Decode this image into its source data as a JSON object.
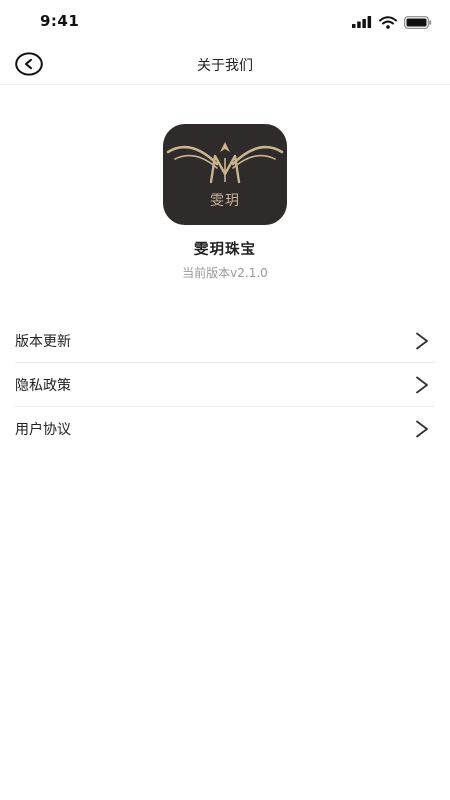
{
  "status_bar": {
    "time": "9:41"
  },
  "nav": {
    "title": "关于我们"
  },
  "app": {
    "logo_text": "雯玥",
    "name": "雯玥珠宝",
    "version": "当前版本v2.1.0"
  },
  "menu": [
    {
      "label": "版本更新"
    },
    {
      "label": "隐私政策"
    },
    {
      "label": "用户协议"
    }
  ],
  "colors": {
    "logo_background": "#2e2b2a",
    "logo_gold": "#c9b48f",
    "divider": "#ececec",
    "version_text": "#9a9a9a"
  },
  "icons": [
    "signal-icon",
    "wifi-icon",
    "battery-icon",
    "back-icon",
    "chevron-right-icon"
  ]
}
